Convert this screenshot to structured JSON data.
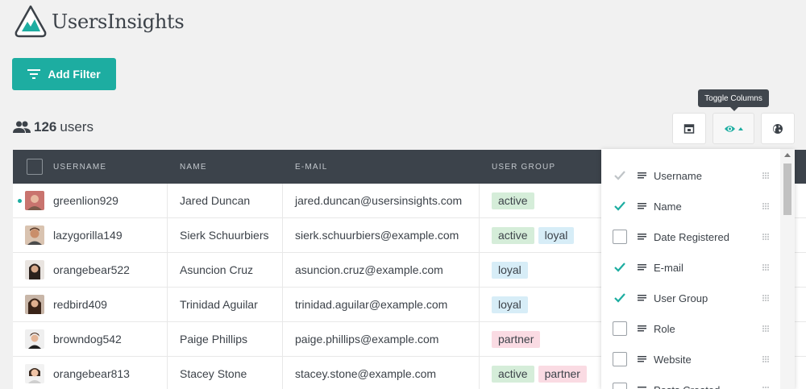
{
  "brand": {
    "name": "UsersInsights",
    "color": "#1dada1"
  },
  "toolbar": {
    "add_filter_label": "Add Filter"
  },
  "summary": {
    "count": "126",
    "unit": "users"
  },
  "tooltip": {
    "text": "Toggle Columns"
  },
  "table": {
    "headers": [
      "USERNAME",
      "NAME",
      "E-MAIL",
      "USER GROUP"
    ],
    "rows": [
      {
        "username": "greenlion929",
        "name": "Jared Duncan",
        "email": "jared.duncan@usersinsights.com",
        "groups": [
          "active"
        ],
        "online": true
      },
      {
        "username": "lazygorilla149",
        "name": "Sierk Schuurbiers",
        "email": "sierk.schuurbiers@example.com",
        "groups": [
          "active",
          "loyal"
        ]
      },
      {
        "username": "orangebear522",
        "name": "Asuncion Cruz",
        "email": "asuncion.cruz@example.com",
        "groups": [
          "loyal"
        ]
      },
      {
        "username": "redbird409",
        "name": "Trinidad Aguilar",
        "email": "trinidad.aguilar@example.com",
        "groups": [
          "loyal"
        ]
      },
      {
        "username": "browndog542",
        "name": "Paige Phillips",
        "email": "paige.phillips@example.com",
        "groups": [
          "partner"
        ]
      },
      {
        "username": "orangebear813",
        "name": "Stacey Stone",
        "email": "stacey.stone@example.com",
        "groups": [
          "active",
          "partner"
        ]
      }
    ]
  },
  "columns_panel": {
    "items": [
      {
        "label": "Username",
        "checked": true,
        "disabled": true
      },
      {
        "label": "Name",
        "checked": true
      },
      {
        "label": "Date Registered",
        "checked": false
      },
      {
        "label": "E-mail",
        "checked": true
      },
      {
        "label": "User Group",
        "checked": true
      },
      {
        "label": "Role",
        "checked": false
      },
      {
        "label": "Website",
        "checked": false
      },
      {
        "label": "Posts Created",
        "checked": false
      }
    ]
  }
}
